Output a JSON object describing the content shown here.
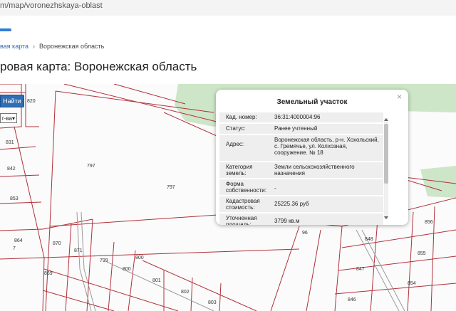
{
  "browser": {
    "url": "m/map/voronezhskaya-oblast"
  },
  "breadcrumb": {
    "first": "вая карта",
    "separator": "›",
    "current": "Воронежская область"
  },
  "page": {
    "title": "ровая карта: Воронежская область"
  },
  "search": {
    "button_label": "Найти",
    "select_value": "т-ва"
  },
  "popup": {
    "title": "Земельный участок",
    "close": "×",
    "rows": [
      {
        "key": "Кад. номер:",
        "value": "36:31:4000004:96"
      },
      {
        "key": "Статус:",
        "value": "Ранее учтенный"
      },
      {
        "key": "Адрес:",
        "value": "Воронежская область, р-н. Хохольский, с. Гремячье, ул. Колхозная, сооружение. № 18"
      },
      {
        "key": "Категория земель:",
        "value": "Земли сельскохозяйственного назначения"
      },
      {
        "key": "Форма собственности:",
        "value": "-"
      },
      {
        "key": "Кадастровая стоимость:",
        "value": "25225.36 руб"
      },
      {
        "key": "Уточненная площадь:",
        "value": "3799 кв.м"
      }
    ]
  },
  "map": {
    "parcel_labels": [
      "820",
      "831",
      "842",
      "853",
      "864",
      "7",
      "797",
      "797",
      "870",
      "871",
      "799",
      "800",
      "800",
      "869",
      "801",
      "802",
      "803",
      "848",
      "855",
      "856",
      "847",
      "854",
      "846",
      "96"
    ]
  }
}
